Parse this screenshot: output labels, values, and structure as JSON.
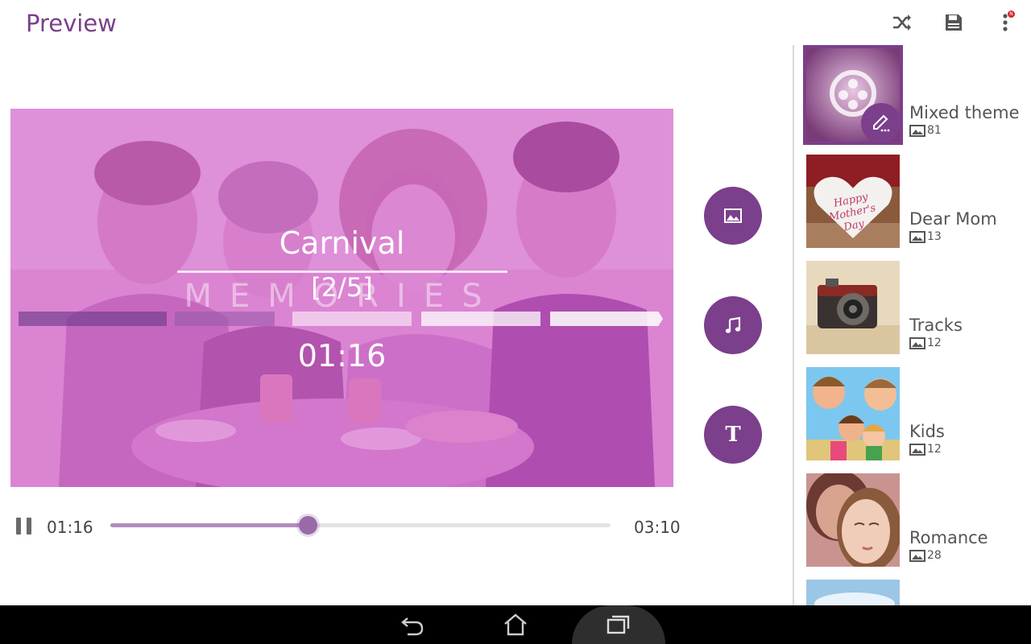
{
  "header": {
    "title": "Preview",
    "icons": [
      "shuffle-icon",
      "save-icon",
      "more-vert-icon"
    ],
    "badge": "N"
  },
  "preview": {
    "overlay_title": "Carnival",
    "counter": "[2/5]",
    "watermark": "MEMORIES",
    "time": "01:16",
    "tint_color": "#d05ac8"
  },
  "side_buttons": {
    "image_icon": "image-icon",
    "music_icon": "music-icon",
    "text_label": "T"
  },
  "playback": {
    "current_time": "01:16",
    "total_time": "03:10",
    "progress": 0.395
  },
  "themes": [
    {
      "name": "Mixed theme",
      "count": "81",
      "selected": true
    },
    {
      "name": "Dear Mom",
      "count": "13",
      "selected": false
    },
    {
      "name": "Tracks",
      "count": "12",
      "selected": false
    },
    {
      "name": "Kids",
      "count": "12",
      "selected": false
    },
    {
      "name": "Romance",
      "count": "28",
      "selected": false
    }
  ],
  "dear_mom_heart_text": "Happy Mother's Day",
  "colors": {
    "accent": "#7b3f8b",
    "title": "#7a3f8c",
    "progress_fill": "#b38bbd",
    "navbar": "#000000"
  },
  "navbar": {
    "icons": [
      "back-icon",
      "home-icon",
      "recent-apps-icon"
    ]
  }
}
